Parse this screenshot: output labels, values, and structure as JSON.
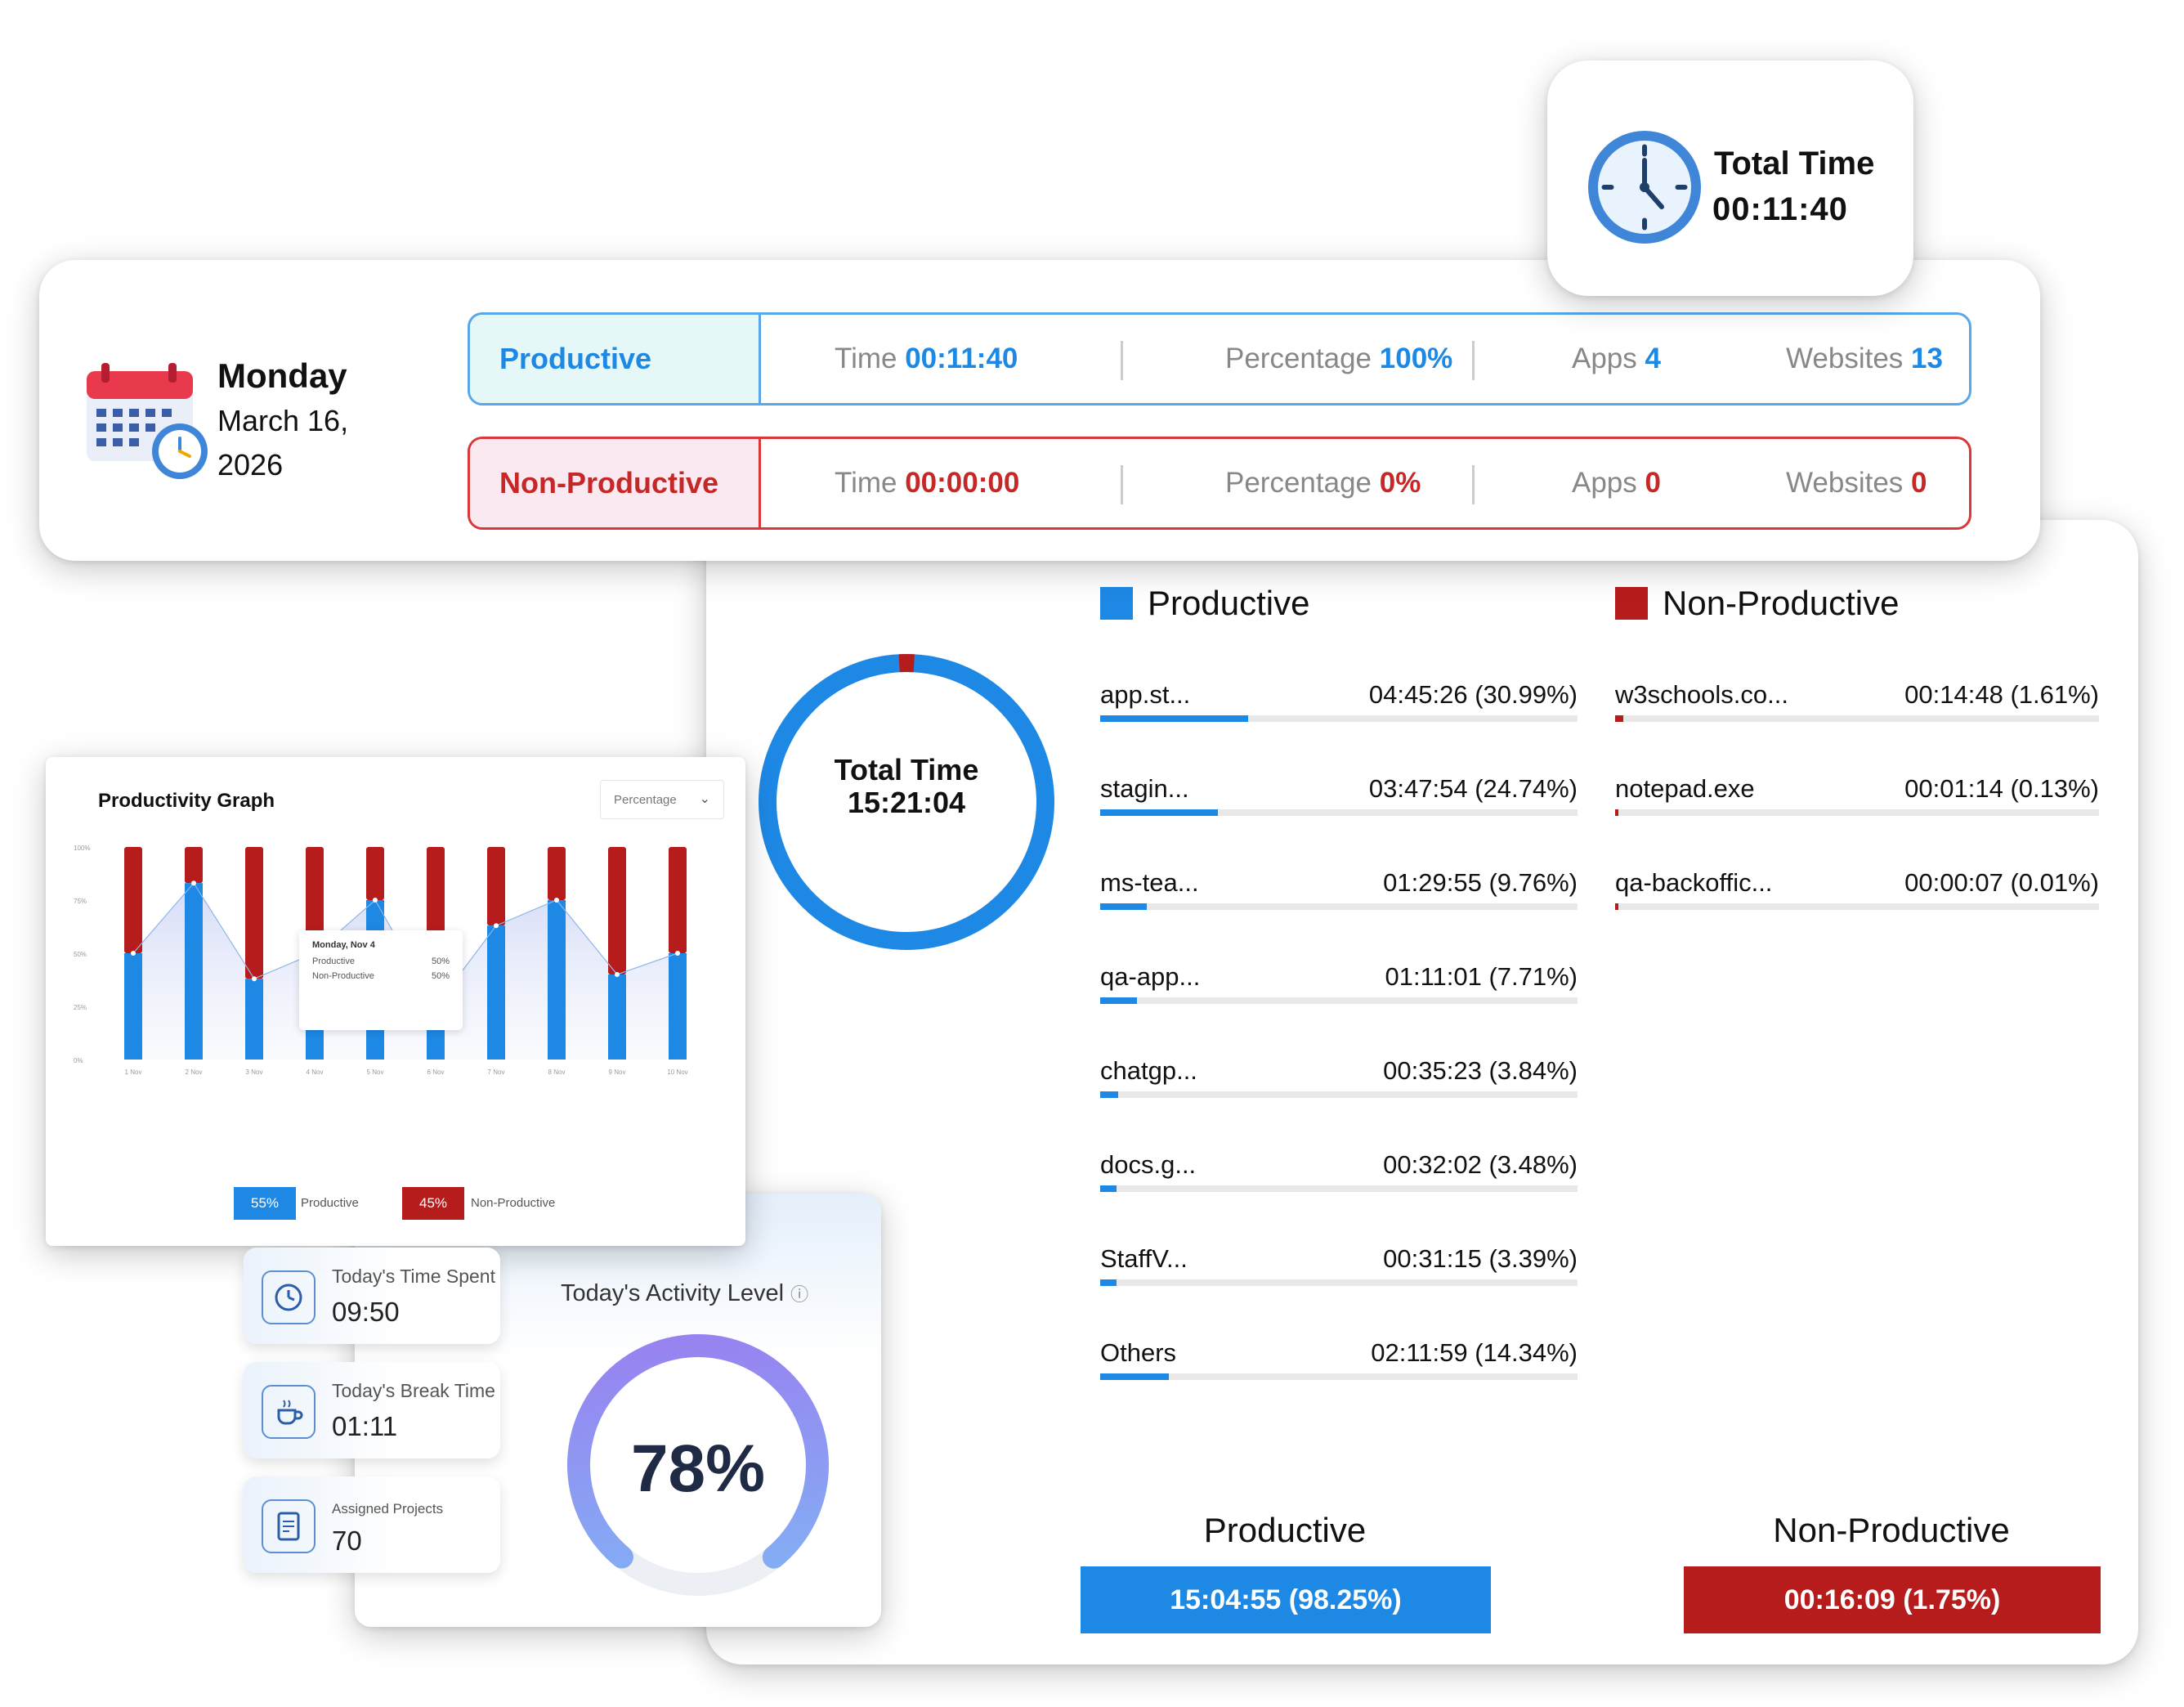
{
  "total_card": {
    "label": "Total Time",
    "value": "00:11:40"
  },
  "date": {
    "day": "Monday",
    "line1": "March 16,",
    "line2": "2026"
  },
  "productive_row": {
    "label": "Productive",
    "time_label": "Time",
    "time": "00:11:40",
    "pct_label": "Percentage",
    "pct": "100%",
    "apps_label": "Apps",
    "apps": "4",
    "web_label": "Websites",
    "web": "13"
  },
  "nonproductive_row": {
    "label": "Non-Productive",
    "time_label": "Time",
    "time": "00:00:00",
    "pct_label": "Percentage",
    "pct": "0%",
    "apps_label": "Apps",
    "apps": "0",
    "web_label": "Websites",
    "web": "0"
  },
  "breakdown": {
    "total_label": "Total Time",
    "total_value": "15:21:04",
    "productive_share": 0.9825,
    "productive_heading": "Productive",
    "nonproductive_heading": "Non-Productive",
    "productive_items": [
      {
        "name": "app.st...",
        "value": "04:45:26 (30.99%)",
        "pct": 30.99
      },
      {
        "name": "stagin...",
        "value": "03:47:54 (24.74%)",
        "pct": 24.74
      },
      {
        "name": "ms-tea...",
        "value": "01:29:55 (9.76%)",
        "pct": 9.76
      },
      {
        "name": "qa-app...",
        "value": "01:11:01 (7.71%)",
        "pct": 7.71
      },
      {
        "name": "chatgp...",
        "value": "00:35:23 (3.84%)",
        "pct": 3.84
      },
      {
        "name": "docs.g...",
        "value": "00:32:02 (3.48%)",
        "pct": 3.48
      },
      {
        "name": "StaffV...",
        "value": "00:31:15 (3.39%)",
        "pct": 3.39
      },
      {
        "name": "Others",
        "value": "02:11:59 (14.34%)",
        "pct": 14.34
      }
    ],
    "nonproductive_items": [
      {
        "name": "w3schools.co...",
        "value": "00:14:48 (1.61%)",
        "pct": 1.61
      },
      {
        "name": "notepad.exe",
        "value": "00:01:14 (0.13%)",
        "pct": 0.13
      },
      {
        "name": "qa-backoffic...",
        "value": "00:00:07 (0.01%)",
        "pct": 0.01
      }
    ],
    "productive_summary": {
      "label": "Productive",
      "value": "15:04:55 (98.25%)"
    },
    "nonproductive_summary": {
      "label": "Non-Productive",
      "value": "00:16:09 (1.75%)"
    }
  },
  "graph": {
    "title": "Productivity Graph",
    "select_value": "Percentage",
    "tooltip": {
      "title": "Monday, Nov 4",
      "rows": [
        {
          "label": "Productive",
          "value": "50%"
        },
        {
          "label": "Non-Productive",
          "value": "50%"
        }
      ]
    },
    "legend": [
      {
        "pct": "55%",
        "label": "Productive"
      },
      {
        "pct": "45%",
        "label": "Non-Productive"
      }
    ]
  },
  "chart_data": {
    "type": "bar",
    "categories": [
      "1 Nov",
      "2 Nov",
      "3 Nov",
      "4 Nov",
      "5 Nov",
      "6 Nov",
      "7 Nov",
      "8 Nov",
      "9 Nov",
      "10 Nov"
    ],
    "series": [
      {
        "name": "Productive",
        "values": [
          50,
          83,
          38,
          50,
          75,
          25,
          63,
          75,
          40,
          50
        ]
      },
      {
        "name": "Non-Productive",
        "values": [
          50,
          17,
          62,
          50,
          25,
          75,
          37,
          25,
          60,
          50
        ]
      }
    ],
    "ylim": [
      0,
      100
    ],
    "yticks": [
      "0%",
      "25%",
      "50%",
      "75%",
      "100%"
    ],
    "stacked": true,
    "colors": {
      "Productive": "#1e88e5",
      "Non-Productive": "#b71c1c"
    }
  },
  "activity": {
    "time_spent_label": "Today's Time Spent",
    "time_spent": "09:50",
    "break_label": "Today's Break Time",
    "break": "01:11",
    "projects_label": "Assigned Projects",
    "projects": "70",
    "level_label": "Today's Activity Level",
    "level_info_icon": "ⓘ",
    "level_value": 78,
    "level_text": "78%"
  },
  "colors": {
    "productive": "#1e88e5",
    "nonproductive": "#b71c1c"
  }
}
